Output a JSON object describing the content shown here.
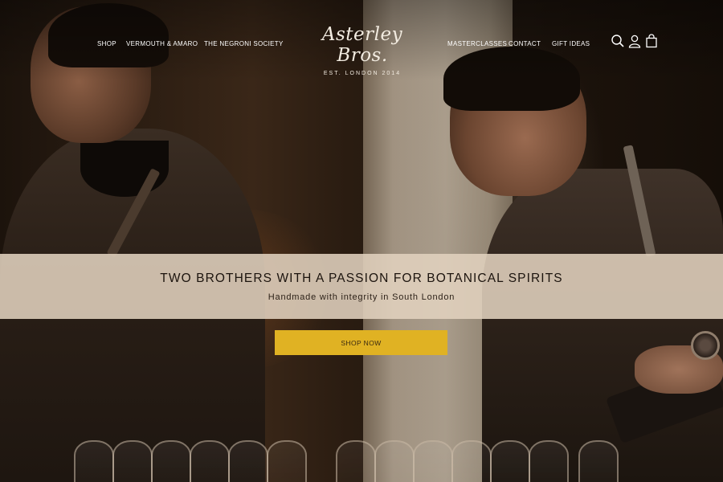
{
  "nav": {
    "left": [
      "SHOP",
      "VERMOUTH & AMARO",
      "THE NEGRONI SOCIETY"
    ],
    "right": [
      "MASTERCLASSES",
      "CONTACT",
      "GIFT IDEAS"
    ]
  },
  "logo": {
    "script": "Asterley Bros.",
    "tagline": "EST. LONDON 2014"
  },
  "icons": [
    "search-icon",
    "account-icon",
    "shopping-bag-icon"
  ],
  "hero": {
    "title": "TWO BROTHERS WITH A PASSION FOR BOTANICAL SPIRITS",
    "subtitle": "Handmade with integrity in South London",
    "cta_label": "SHOP NOW"
  },
  "colors": {
    "cta_background": "#e0b223",
    "banner_background": "#e1d2be",
    "nav_text": "#ffffff"
  }
}
